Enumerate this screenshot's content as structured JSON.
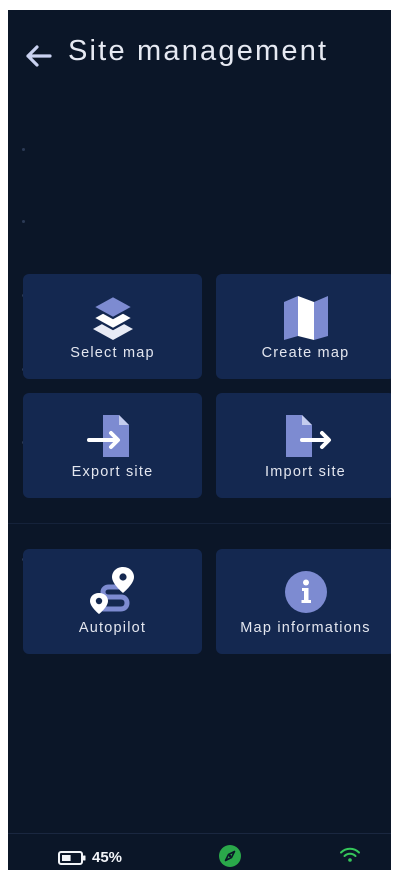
{
  "header": {
    "title": "Site management"
  },
  "tiles": [
    {
      "label": "Select map",
      "icon": "layers-icon"
    },
    {
      "label": "Create map",
      "icon": "folded-map-icon"
    },
    {
      "label": "Export site",
      "icon": "file-export-icon"
    },
    {
      "label": "Import site",
      "icon": "file-import-icon"
    },
    {
      "label": "Autopilot",
      "icon": "route-icon"
    },
    {
      "label": "Map informations",
      "icon": "info-icon"
    }
  ],
  "status": {
    "battery": "45%",
    "battery_level": 0.45
  },
  "colors": {
    "background": "#0b1628",
    "tile": "#142850",
    "icon": "#7d8bd1",
    "text": "#e3e6ef",
    "compass": "#2aa84a",
    "wifi": "#35c75a"
  }
}
